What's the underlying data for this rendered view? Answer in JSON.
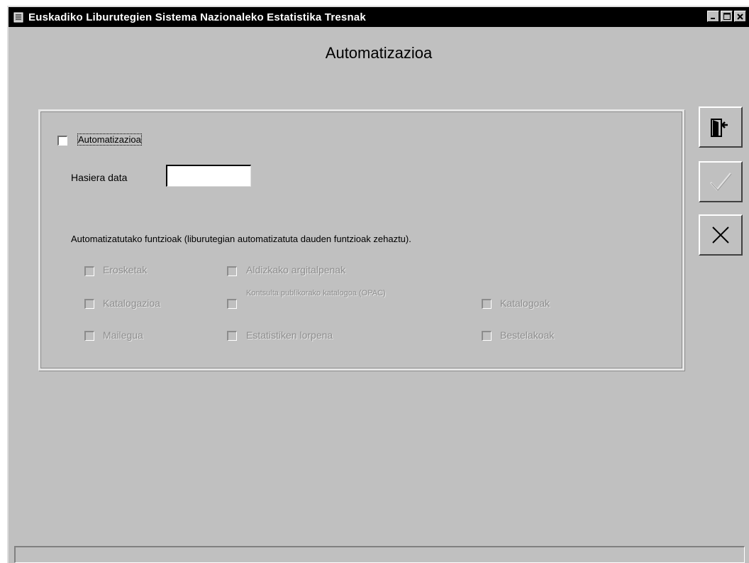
{
  "window": {
    "title": "Euskadiko Liburutegien Sistema Nazionaleko Estatistika Tresnak",
    "icon": "app-book-icon",
    "controls": [
      "minimize-icon",
      "maximize-icon",
      "close-icon"
    ]
  },
  "page": {
    "heading": "Automatizazioa"
  },
  "form": {
    "automatizazioa": {
      "label": "Automatizazioa",
      "checked": false
    },
    "start_date": {
      "label": "Hasiera data",
      "value": ""
    },
    "functions_caption": "Automatizatutako funtzioak (liburutegian automatizatuta dauden funtzioak zehaztu).",
    "functions": [
      {
        "label": "Erosketak",
        "checked": false,
        "enabled": false
      },
      {
        "label": "Aldizkako argitalpenak",
        "checked": false,
        "enabled": false
      },
      {
        "label": "Katalogazioa",
        "checked": false,
        "enabled": false
      },
      {
        "label": "Kontsulta publikorako katalogoa (OPAC)",
        "checked": false,
        "enabled": false
      },
      {
        "label": "Katalogoak",
        "checked": false,
        "enabled": false
      },
      {
        "label": "Mailegua",
        "checked": false,
        "enabled": false
      },
      {
        "label": "Estatistiken lorpena",
        "checked": false,
        "enabled": false
      },
      {
        "label": "Bestelakoak",
        "checked": false,
        "enabled": false
      }
    ]
  },
  "actions": [
    {
      "name": "exit",
      "icon": "exit-door-icon",
      "enabled": true
    },
    {
      "name": "accept",
      "icon": "checkmark-icon",
      "enabled": false
    },
    {
      "name": "cancel",
      "icon": "x-icon",
      "enabled": true
    }
  ],
  "statusbar": {
    "text": ""
  }
}
